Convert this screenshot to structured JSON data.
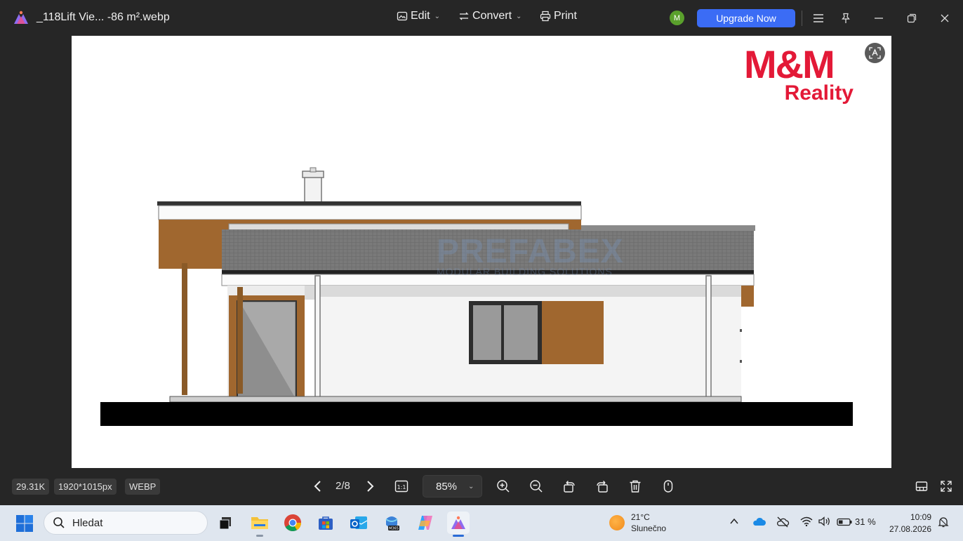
{
  "titlebar": {
    "file_name": "_118Lift Vie... -86 m².webp",
    "menu": [
      {
        "label": "Edit",
        "icon": "edit-image-icon",
        "has_dropdown": true
      },
      {
        "label": "Convert",
        "icon": "convert-icon",
        "has_dropdown": true
      },
      {
        "label": "Print",
        "icon": "printer-icon",
        "has_dropdown": false
      }
    ],
    "avatar_initial": "M",
    "upgrade_label": "Upgrade Now",
    "accent_color": "#3b6cf5"
  },
  "image": {
    "brand_line1": "M&M",
    "brand_line2": "Reality",
    "brand_color": "#e31937",
    "watermark_main": "PREFABEX",
    "watermark_sub": "MODULAR BUILDING SOLUTIONS"
  },
  "bottombar": {
    "file_size": "29.31K",
    "dimensions": "1920*1015px",
    "format": "WEBP",
    "page_indicator": "2/8",
    "fit_label": "1:1",
    "zoom_value": "85%"
  },
  "taskbar": {
    "search_placeholder": "Hledat",
    "weather_temp": "21°C",
    "weather_desc": "Slunečno",
    "battery": "31 %",
    "time": "10:09",
    "date": "27.08.2026"
  }
}
